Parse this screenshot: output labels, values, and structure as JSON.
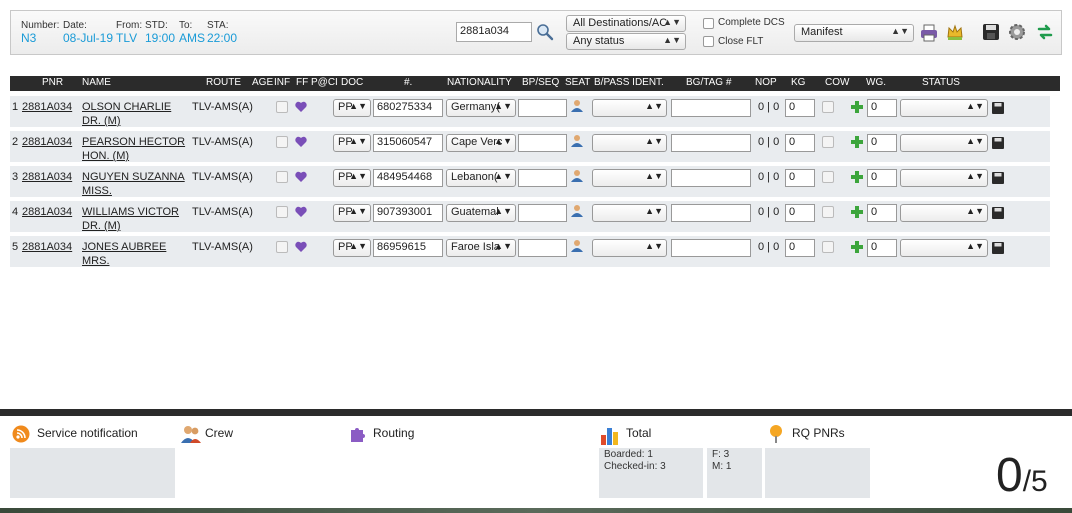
{
  "header": {
    "number_label": "Number:",
    "date_label": "Date:",
    "from_label": "From:",
    "std_label": "STD:",
    "to_label": "To:",
    "sta_label": "STA:",
    "number": "N3",
    "date": "08-Jul-19",
    "from": "TLV",
    "std": "19:00",
    "to": "AMS",
    "sta": "22:00",
    "search_value": "2881a034",
    "destinations_select": "All Destinations/AC",
    "status_select": "Any status",
    "complete_dcs_label": "Complete DCS",
    "close_flt_label": "Close FLT",
    "report_select": "Manifest"
  },
  "columns": [
    "PNR",
    "NAME",
    "ROUTE",
    "AGE",
    "INF",
    "FF",
    "P@CI",
    "DOC",
    "#.",
    "NATIONALITY",
    "BP/SEQ",
    "SEAT",
    "B/PASS IDENT.",
    "BG/TAG #",
    "NOP",
    "KG",
    "COW",
    "WG.",
    "STATUS"
  ],
  "rows": [
    {
      "num": "1",
      "pnr": "2881A034",
      "name": "OLSON CHARLIE DR. (M)",
      "route": "TLV-AMS(A)",
      "doc": "PP",
      "doc_no": "680275334",
      "nationality": "Germany(",
      "nop": "0 | 0",
      "kg": "0",
      "wg": "0"
    },
    {
      "num": "2",
      "pnr": "2881A034",
      "name": "PEARSON HECTOR HON. (M)",
      "route": "TLV-AMS(A)",
      "doc": "PP",
      "doc_no": "315060547",
      "nationality": "Cape Verc",
      "nop": "0 | 0",
      "kg": "0",
      "wg": "0"
    },
    {
      "num": "3",
      "pnr": "2881A034",
      "name": "NGUYEN SUZANNA MISS.",
      "route": "TLV-AMS(A)",
      "doc": "PP",
      "doc_no": "484954468",
      "nationality": "Lebanon(",
      "nop": "0 | 0",
      "kg": "0",
      "wg": "0"
    },
    {
      "num": "4",
      "pnr": "2881A034",
      "name": "WILLIAMS VICTOR DR. (M)",
      "route": "TLV-AMS(A)",
      "doc": "PP",
      "doc_no": "907393001",
      "nationality": "Guatemal",
      "nop": "0 | 0",
      "kg": "0",
      "wg": "0"
    },
    {
      "num": "5",
      "pnr": "2881A034",
      "name": "JONES AUBREE MRS.",
      "route": "TLV-AMS(A)",
      "doc": "PP",
      "doc_no": "86959615",
      "nationality": "Faroe Isla",
      "nop": "0 | 0",
      "kg": "0",
      "wg": "0"
    }
  ],
  "footer": {
    "service_title": "Service notification",
    "crew_title": "Crew",
    "routing_title": "Routing",
    "total_title": "Total",
    "boarded": "Boarded: 1",
    "checked_in": "Checked-in: 3",
    "f_count": "F: 3",
    "m_count": "M: 1",
    "rq_title": "RQ PNRs",
    "count_done": "0",
    "count_sep": "/",
    "count_total": "5"
  },
  "colors": {
    "accent_blue": "#1a9bd7",
    "header_dark": "#2b2b2b",
    "row_bg": "#e9ecef"
  },
  "icons": [
    "search-icon",
    "printer-icon",
    "crown-icon",
    "save-icon",
    "gear-icon",
    "refresh-icon",
    "heart-icon",
    "person-icon",
    "plus-icon",
    "rss-icon",
    "crew-icon",
    "puzzle-icon",
    "bar-chart-icon",
    "pin-icon"
  ]
}
